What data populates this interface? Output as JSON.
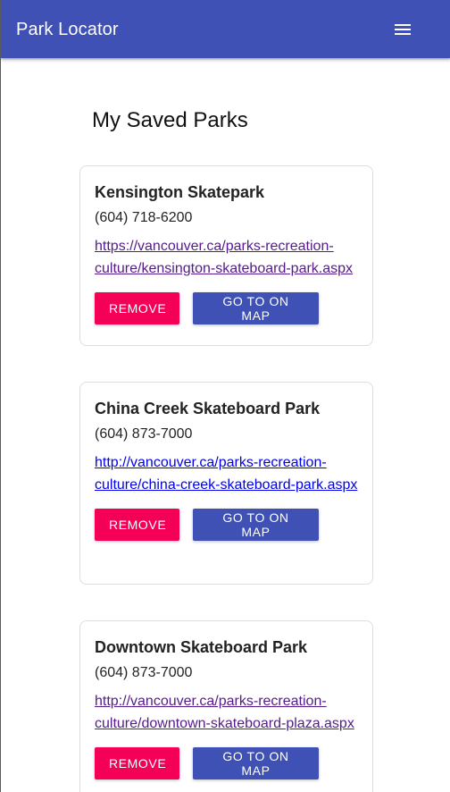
{
  "app": {
    "title": "Park Locator",
    "menu_icon": "menu-icon",
    "brand_color": "#3f51b5",
    "accent_color": "#f50057"
  },
  "main": {
    "heading": "My Saved Parks",
    "remove_label": "REMOVE",
    "map_label": "GO TO ON MAP",
    "parks": [
      {
        "name": "Kensington Skatepark",
        "phone": "(604) 718-6200",
        "url": "https://vancouver.ca/parks-recreation-culture/kensington-skateboard-park.aspx"
      },
      {
        "name": "China Creek Skateboard Park",
        "phone": "(604) 873-7000",
        "url": "http://vancouver.ca/parks-recreation-culture/china-creek-skateboard-park.aspx"
      },
      {
        "name": "Downtown Skateboard Park",
        "phone": "(604) 873-7000",
        "url": "http://vancouver.ca/parks-recreation-culture/downtown-skateboard-plaza.aspx"
      }
    ]
  }
}
